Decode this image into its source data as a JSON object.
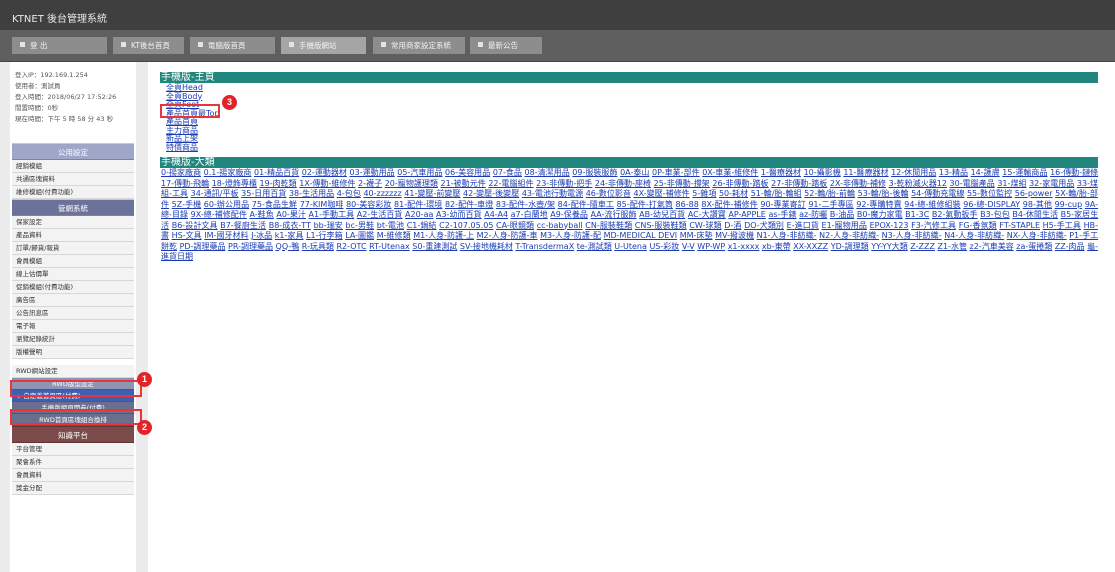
{
  "app": {
    "title": "KTNET 後台管理系統"
  },
  "top_nav": [
    {
      "label": "登 出"
    },
    {
      "label": "KT後台首頁"
    },
    {
      "label": "電腦版首頁"
    },
    {
      "label": "手機版網站"
    },
    {
      "label": "常用商家設定系統"
    },
    {
      "label": "最新公告"
    }
  ],
  "login_info": {
    "ip": "登入IP：192.169.1.254",
    "user": "使用者：測試員",
    "login_time": "登入時間：2018/06/27 17:52:26",
    "idle_time": "閒置時間：0秒",
    "current_time": "現在時間：下午 5 時 58 分 43 秒"
  },
  "sidebar": {
    "sections": [
      {
        "title": "公用設定",
        "items": [
          "經銷模組",
          "共通區塊資料",
          "維修模組(付費功能)"
        ]
      },
      {
        "title": "管網系統",
        "items": [
          "保家設定",
          "產品資料",
          "訂單/歸貨/報貨",
          "會員模組",
          "線上估價單",
          "促銷模組(付費功能)",
          "廣告區",
          "公告訊息區",
          "電子報",
          "瀏覽紀錄統計",
          "版權聲明"
        ]
      }
    ],
    "rwd_item": "RWD網站設定",
    "rwd_subs": [
      "RWD版型設定",
      "自定義首頁區(付費)",
      "手機版網頁開卷(付費)",
      "RWD首頁區塊組合換排"
    ],
    "section3": {
      "title": "知識平台",
      "items": [
        "平台管理",
        "聚會系件",
        "會員資料",
        "獎金分配"
      ]
    }
  },
  "content": {
    "header1": "手機版-主頁",
    "nav_links": [
      "全頁Head",
      "全頁Body",
      "全頁Foot",
      "產品首頁最Top",
      "產品首頁",
      "主力商品",
      "新品上架",
      "特價商品"
    ],
    "header2": "手機版-大類",
    "categories": [
      "0-揚家廠商",
      "0.1-揚家廠商",
      "01-精品百貨",
      "02-運動器材",
      "03-運動用品",
      "05-汽車用品",
      "06-美容用品",
      "07-食品",
      "08-清潔用品",
      "09-服裝服飾",
      "0A-泰山",
      "0P-車業-部件",
      "0X-車業-維修件",
      "1-醫療器材",
      "10-攝影機",
      "11-醫療器材",
      "12-休閒用品",
      "13-精品",
      "14-護膚",
      "15-運輸商品",
      "16-傳動-鏈條",
      "17-傳動-飛輪",
      "18-燈飾專櫃",
      "19-肉乾類",
      "1X-傳動-維修件",
      "2-襪子",
      "20-寵物護理類",
      "21-被動元件",
      "22-電腦組件",
      "23-非傳動-把手",
      "24-非傳動-座椅",
      "25-非傳動-撐架",
      "26-非傳動-踏板",
      "27-非傳動-踏板",
      "2X-非傳動-補修",
      "3-乾粉滅火器12",
      "30-電腦產品",
      "31-煤組",
      "32-家電用品",
      "33-煤組-工具",
      "34-通訊/平板",
      "35-日用百貨",
      "38-生活用品",
      "4-包包",
      "40-zzzzzz",
      "41-變壓-前變壓",
      "42-變壓-後變壓",
      "43-電池行動電源",
      "46-數位影音",
      "4X-變壓-補修件",
      "5-雜項",
      "50-耗材",
      "51-輪/胎-輪組",
      "52-輪/胎-前輪",
      "53-輪/胎-後輪",
      "54-傳動充電線",
      "55-數位監控",
      "56-power",
      "5X-輪/胎-部件",
      "5Z-手機",
      "60-辦公用品",
      "75-食品生鮮",
      "77-KIM咖啡",
      "80-美容彩妝",
      "81-配件-環境",
      "82-配件-車燈",
      "83-配件-水壺/架",
      "84-配件-隨車工",
      "85-配件-打氣筒",
      "86-88",
      "8X-配件-補修件",
      "90-專業寄訂",
      "91-二手專區",
      "92-專購特賣",
      "94-總-維修組裝",
      "96-總-DISPLAY",
      "98-其他",
      "99-cup",
      "9A-總-目錄",
      "9X-總-補修配件",
      "A-鞋魚",
      "A0-果汁",
      "A1-手動工具",
      "A2-生活百貨",
      "A20-aa",
      "A3-幼而百貨",
      "A4-A4",
      "a7-白蘭地",
      "A9-保養品",
      "AA-流行服飾",
      "AB-幼兒百貨",
      "AC-大讚寶",
      "AP-APPLE",
      "as-手錶",
      "az-防曬",
      "B-油品",
      "B0-魔力家電",
      "B1-3C",
      "B2-氣動扳手",
      "B3-包包",
      "B4-休閒生活",
      "B5-家居生活",
      "B6-設計文具",
      "B7-餐廚生活",
      "B8-成衣-TT",
      "bb-瑞安",
      "bc-男鞋",
      "bt-電池",
      "C1-鍋結",
      "C2-107.05.05",
      "CA-眼鏡類",
      "cc-babyball",
      "CN-服裝鞋類",
      "CNS-服裝鞋類",
      "CW-球類",
      "D-酒",
      "DO-犬類別",
      "E-進口貨",
      "E1-寵物用品",
      "EPOX-123",
      "F3-汽修工具",
      "FG-香氛類",
      "FT-STAPLE",
      "H5-手工具",
      "HB-書",
      "HS-文具",
      "IM-國牙材料",
      "J-冰品",
      "k1-家具",
      "L1-行李箱",
      "LA-圖鑑",
      "M-維修類",
      "M1-人身-防護-上",
      "M2-人身-防護-車",
      "M3-人身-防護-配",
      "MD-MEDICAL DEVI",
      "MM-床墊",
      "MV-撥波機",
      "N1-人身-非紡織-",
      "N2-人身-非紡織-",
      "N3-人身-非紡織-",
      "N4-人身-非紡織-",
      "NX-人身-非紡織-",
      "P1-手工餅乾",
      "PD-調理藥品",
      "PR-調理藥品",
      "QQ-鴨",
      "R-玩具類",
      "R2-OTC",
      "RT-Utenax",
      "S0-重建測試",
      "SV-接地機耗材",
      "T-TransdermaX",
      "te-測試類",
      "U-Utena",
      "US-彩妝",
      "V-V",
      "WP-WP",
      "x1-xxxx",
      "xb-東帶",
      "XX-XXZZ",
      "YD-調理類",
      "YY-YY大類",
      "Z-ZZZ",
      "Z1-水管",
      "z2-汽車美容",
      "za-蛋捲類",
      "ZZ-肉品",
      "龜-進貨日期"
    ]
  },
  "annotations": [
    "1",
    "2",
    "3"
  ],
  "colors": {
    "header_teal": "#21867d",
    "link_blue": "#1b3cb4",
    "annotation_red": "#e02427"
  }
}
